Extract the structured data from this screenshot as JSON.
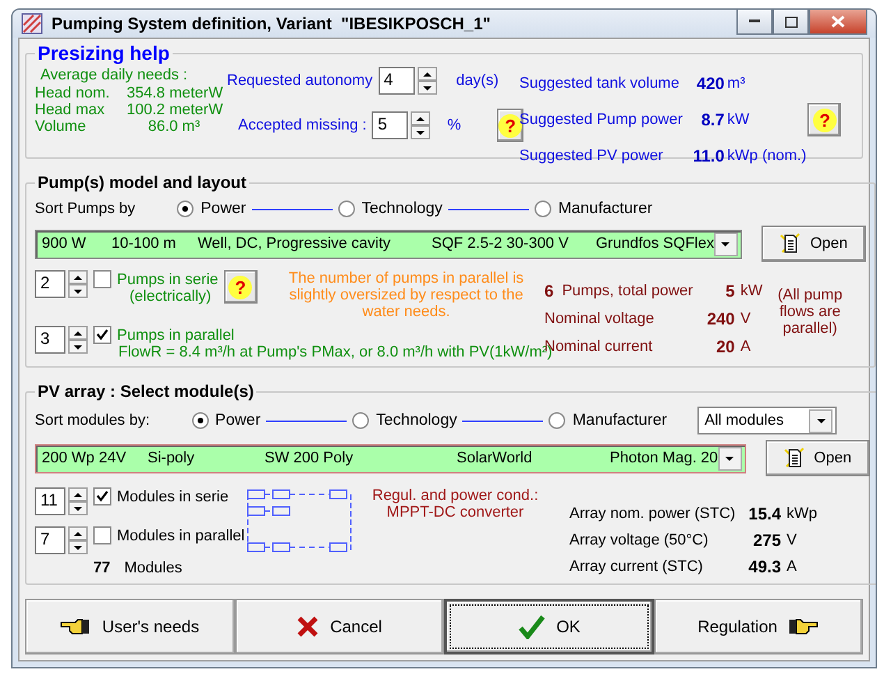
{
  "window": {
    "title": "Pumping System definition, Variant  \"IBESIKPOSCH_1\""
  },
  "presizing": {
    "title": "Presizing help",
    "needs_label": "Average daily needs :",
    "needs": [
      {
        "label": "Head nom.",
        "value": "354.8 meterW"
      },
      {
        "label": "Head max",
        "value": "100.2 meterW"
      },
      {
        "label": "Volume",
        "value": "86.0 m³"
      }
    ],
    "autonomy": {
      "label": "Requested autonomy",
      "value": "4",
      "unit": "day(s)"
    },
    "missing": {
      "label": "Accepted missing :",
      "value": "5",
      "unit": "%"
    },
    "missing_help": "?",
    "suggested": [
      {
        "label": "Suggested tank volume",
        "value": "420",
        "unit": "m³"
      },
      {
        "label": "Suggested Pump power",
        "value": "8.7",
        "unit": "kW"
      },
      {
        "label": "Suggested PV power",
        "value": "11.0",
        "unit": "kWp (nom.)"
      }
    ],
    "suggested_help": "?"
  },
  "pumps": {
    "title": "Pump(s)  model and layout",
    "sort_label": "Sort Pumps by",
    "sort_options": [
      {
        "label": "Power",
        "selected": true
      },
      {
        "label": "Technology",
        "selected": false
      },
      {
        "label": "Manufacturer",
        "selected": false
      }
    ],
    "selection": [
      "900 W",
      "10-100 m",
      "Well, DC, Progressive cavity",
      "SQF 2.5-2  30-300 V",
      "Grundfos SQFlex"
    ],
    "open": "Open",
    "serie": {
      "value": "2",
      "label": "Pumps in serie",
      "sub": "(electrically)",
      "checked": false
    },
    "help": "?",
    "warning": "The number of pumps in parallel is slightly oversized by respect to the water needs.",
    "parallel": {
      "value": "3",
      "label": "Pumps in parallel",
      "checked": true
    },
    "flow": "FlowR = 8.4 m³/h at Pump's PMax, or 8.0 m³/h with PV(1kW/m²)",
    "count": "6",
    "count_label": "Pumps,  total power",
    "total": "5",
    "total_unit": "kW",
    "stats": [
      {
        "label": "Nominal voltage",
        "value": "240",
        "unit": "V"
      },
      {
        "label": "Nominal current",
        "value": "20",
        "unit": "A"
      }
    ],
    "note": "(All pump flows are parallel)"
  },
  "pv": {
    "title": "PV array : Select module(s)",
    "sort_label": "Sort modules by:",
    "sort_options": [
      {
        "label": "Power",
        "selected": true
      },
      {
        "label": "Technology",
        "selected": false
      },
      {
        "label": "Manufacturer",
        "selected": false
      }
    ],
    "filter": "All modules",
    "selection": [
      "200 Wp 24V",
      "Si-poly",
      "SW 200 Poly",
      "SolarWorld",
      "Photon Mag. 20"
    ],
    "open": "Open",
    "serie": {
      "value": "11",
      "label": "Modules in serie",
      "checked": true
    },
    "parallel": {
      "value": "7",
      "label": "Modules in parallel",
      "checked": false
    },
    "total": "77",
    "total_label": "Modules",
    "regulation": [
      "Regul. and power cond.:",
      "MPPT-DC converter"
    ],
    "stats": [
      {
        "label": "Array nom. power (STC)",
        "value": "15.4",
        "unit": "kWp"
      },
      {
        "label": "Array voltage  (50°C)",
        "value": "275",
        "unit": "V"
      },
      {
        "label": "Array current  (STC)",
        "value": "49.3",
        "unit": "A"
      }
    ]
  },
  "buttons": [
    {
      "label": "User's needs",
      "kind": "back",
      "default": false
    },
    {
      "label": "Cancel",
      "kind": "cancel",
      "default": false
    },
    {
      "label": "OK",
      "kind": "ok",
      "default": true
    },
    {
      "label": "Regulation",
      "kind": "next",
      "default": false
    }
  ]
}
